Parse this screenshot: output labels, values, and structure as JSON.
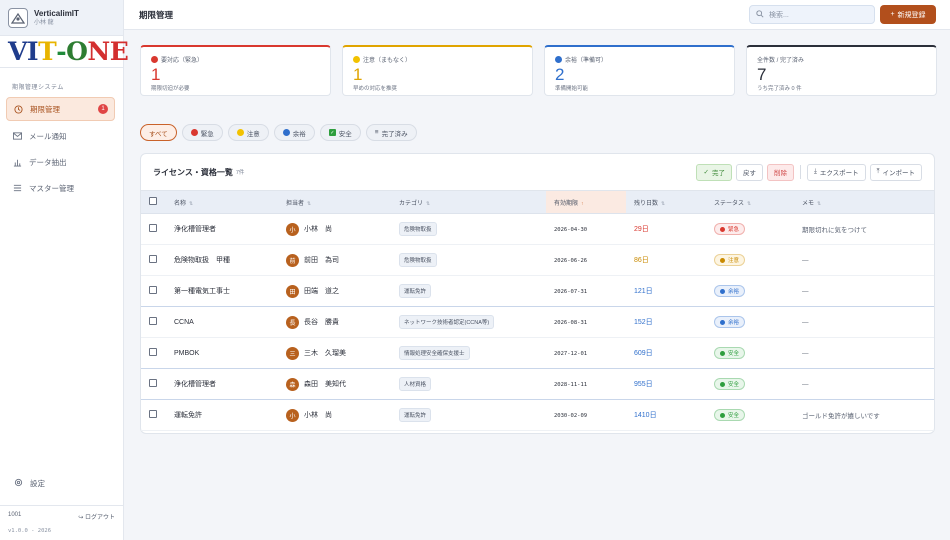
{
  "sidebar": {
    "workspace_name": "VerticalimIT",
    "workspace_sub": "小林 龍",
    "logo_letters": [
      {
        "ch": "V",
        "color": "#1f3c8c"
      },
      {
        "ch": "I",
        "color": "#1f3c8c"
      },
      {
        "ch": "T",
        "color": "#e8b400"
      },
      {
        "ch": "-",
        "color": "#1f8a3a"
      },
      {
        "ch": "O",
        "color": "#2e7d32"
      },
      {
        "ch": "N",
        "color": "#d32f2f"
      },
      {
        "ch": "E",
        "color": "#d32f2f"
      }
    ],
    "section_label": "期限管理システム",
    "items": [
      {
        "label": "期限管理",
        "icon": "clock-icon",
        "badge": "1"
      },
      {
        "label": "メール通知",
        "icon": "mail-icon"
      },
      {
        "label": "データ抽出",
        "icon": "chart-icon"
      },
      {
        "label": "マスター管理",
        "icon": "list-icon"
      }
    ],
    "settings_label": "設定",
    "user_id": "1001",
    "logout_label": "ログアウト",
    "version": "v1.0.0 - 2026"
  },
  "header": {
    "title": "期限管理",
    "search_placeholder": "検索...",
    "new_button": "新規登録"
  },
  "summary_cards": [
    {
      "label": "要対応（緊急）",
      "value": "1",
      "desc": "期限切迫が必要",
      "color": "#d9382f",
      "dot": "#d9382f"
    },
    {
      "label": "注意（まもなく）",
      "value": "1",
      "desc": "早めの対応を推奨",
      "color": "#e0a400",
      "dot": "#f2c200"
    },
    {
      "label": "余裕（準備可）",
      "value": "2",
      "desc": "準備開始可能",
      "color": "#2f6fcc",
      "dot": "#2f6fcc"
    },
    {
      "label": "全件数 / 完了済み",
      "value": "7",
      "desc": "うち完了済み 0 件",
      "color": "#2b2f3a",
      "dot": ""
    }
  ],
  "filters": [
    {
      "label": "すべて",
      "dot": "",
      "active": true
    },
    {
      "label": "緊急",
      "dot": "#d9382f"
    },
    {
      "label": "注意",
      "dot": "#f2c200"
    },
    {
      "label": "余裕",
      "dot": "#2f6fcc"
    },
    {
      "label": "安全",
      "dot": "#2e9e3e",
      "check": true
    },
    {
      "label": "完了済み",
      "dot": "",
      "prefix": "≡"
    }
  ],
  "panel": {
    "title": "ライセンス・資格一覧",
    "count": "7件",
    "actions": {
      "complete": "完了",
      "restore": "戻す",
      "delete": "削除",
      "export": "エクスポート",
      "import": "インポート"
    }
  },
  "table": {
    "headers": [
      "名称",
      "担当者",
      "カテゴリ",
      "有効期限",
      "残り日数",
      "ステータス",
      "メモ"
    ],
    "rows": [
      {
        "name": "浄化槽管理者",
        "owner_initial": "小",
        "owner": "小林　尚",
        "category": "危険物取扱",
        "date": "2026-04-30",
        "days": "29日",
        "days_color": "#d9382f",
        "status": "緊急",
        "status_color": "#d9382f",
        "status_bg": "#fdecec",
        "memo": "期限切れに気をつけて"
      },
      {
        "name": "危険物取扱　甲種",
        "owner_initial": "前",
        "owner": "前田　為司",
        "category": "危険物取扱",
        "date": "2026-06-26",
        "days": "86日",
        "days_color": "#c98a00",
        "status": "注意",
        "status_color": "#c98a00",
        "status_bg": "#fdf5e2",
        "memo": "—"
      },
      {
        "name": "第一種電気工事士",
        "owner_initial": "田",
        "owner": "田端　道之",
        "category": "運転免許",
        "date": "2026-07-31",
        "days": "121日",
        "days_color": "#2f6fcc",
        "status": "余裕",
        "status_color": "#2f6fcc",
        "status_bg": "#e9f0fb",
        "memo": "—"
      },
      {
        "name": "CCNA",
        "owner_initial": "長",
        "owner": "長谷　勝貴",
        "category": "ネットワーク技術者認定(CCNA等)",
        "date": "2026-08-31",
        "days": "152日",
        "days_color": "#2f6fcc",
        "status": "余裕",
        "status_color": "#2f6fcc",
        "status_bg": "#e9f0fb",
        "memo": "—"
      },
      {
        "name": "PMBOK",
        "owner_initial": "三",
        "owner": "三木　久瑠美",
        "category": "情報処理安全確保支援士",
        "date": "2027-12-01",
        "days": "609日",
        "days_color": "#2f6fcc",
        "status": "安全",
        "status_color": "#2e9e3e",
        "status_bg": "#e8f6ea",
        "memo": "—"
      },
      {
        "name": "浄化槽管理者",
        "owner_initial": "森",
        "owner": "森田　美知代",
        "category": "人材資格",
        "date": "2028-11-11",
        "days": "955日",
        "days_color": "#2f6fcc",
        "status": "安全",
        "status_color": "#2e9e3e",
        "status_bg": "#e8f6ea",
        "memo": "—"
      },
      {
        "name": "運転免許",
        "owner_initial": "小",
        "owner": "小林　尚",
        "category": "運転免許",
        "date": "2030-02-09",
        "days": "1410日",
        "days_color": "#2f6fcc",
        "status": "安全",
        "status_color": "#2e9e3e",
        "status_bg": "#e8f6ea",
        "memo": "ゴールド免許が嬉しいです"
      }
    ]
  }
}
